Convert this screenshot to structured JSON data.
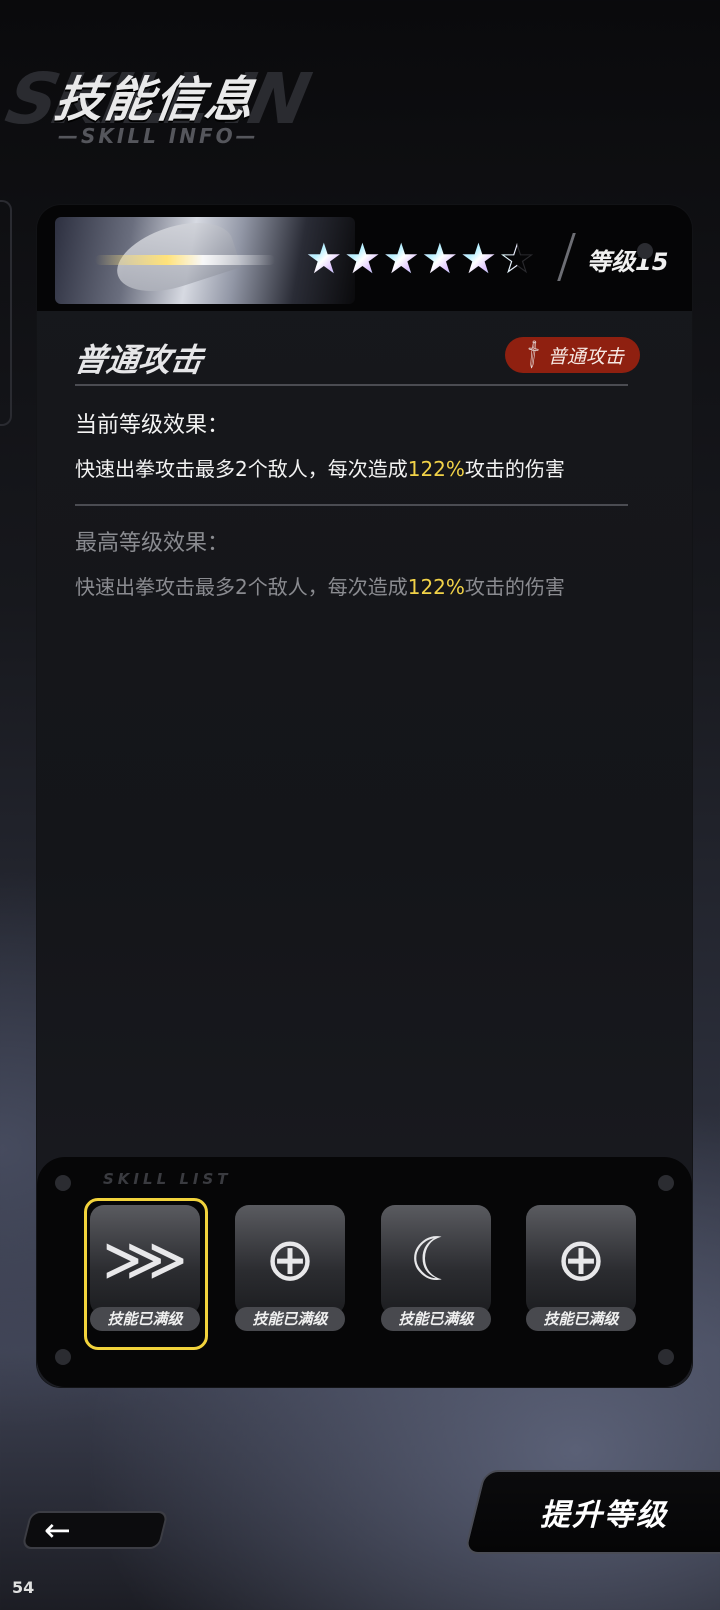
{
  "header": {
    "title": "技能信息",
    "subtitle": "—SKILL INFO—",
    "bg_text": "SKILL IN"
  },
  "character": {
    "stars": [
      "★",
      "★",
      "★",
      "★",
      "★",
      "☆"
    ],
    "level_label": "等级15"
  },
  "skill": {
    "name": "普通攻击",
    "type_tag": "普通攻击",
    "current_label": "当前等级效果：",
    "current_desc_pre": "快速出拳攻击最多2个敌人，每次造成",
    "current_desc_value": "122%",
    "current_desc_post": "攻击的伤害",
    "max_label": "最高等级效果：",
    "max_desc_pre": "快速出拳攻击最多2个敌人，每次造成",
    "max_desc_value": "122%",
    "max_desc_post": "攻击的伤害"
  },
  "skill_bar": {
    "label": "SKILL LIST",
    "slots": [
      {
        "icon": "claw-icon",
        "glyph": "⋙",
        "caption": "技能已满级",
        "selected": true
      },
      {
        "icon": "crosshair-icon",
        "glyph": "⊕",
        "caption": "技能已满级",
        "selected": false
      },
      {
        "icon": "slash-icon",
        "glyph": "☾",
        "caption": "技能已满级",
        "selected": false
      },
      {
        "icon": "crosshair-icon",
        "glyph": "⊕",
        "caption": "技能已满级",
        "selected": false
      }
    ]
  },
  "buttons": {
    "back_glyph": "←",
    "upgrade": "提升等级"
  },
  "status": {
    "page_number": "54"
  },
  "colors": {
    "highlight": "#f1d248",
    "tag_bg": "#8f2010",
    "selected_border": "#f2d33c"
  }
}
